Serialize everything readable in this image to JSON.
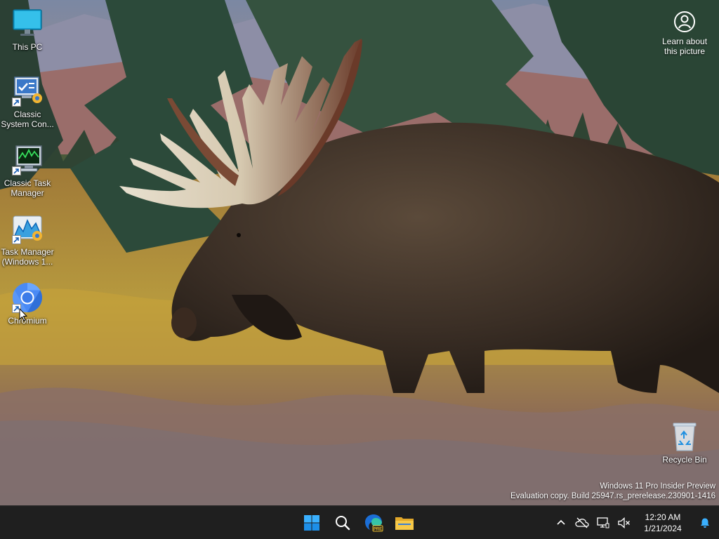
{
  "desktop": {
    "icons": [
      {
        "label": "This PC",
        "icon": "monitor-icon"
      },
      {
        "label": "Classic System Con...",
        "icon": "control-panel-icon"
      },
      {
        "label": "Classic Task Manager",
        "icon": "task-manager-classic-icon"
      },
      {
        "label": "Task Manager (Windows 1...",
        "icon": "task-manager-icon"
      },
      {
        "label": "Chromium",
        "icon": "chromium-icon"
      }
    ],
    "recycle_bin": {
      "label": "Recycle Bin",
      "icon": "recycle-bin-icon"
    },
    "learn_about": {
      "label": "Learn about this picture",
      "icon": "camera-info-icon"
    }
  },
  "watermark": {
    "line1": "Windows 11 Pro Insider Preview",
    "line2": "Evaluation copy. Build 25947.rs_prerelease.230901-1416"
  },
  "taskbar": {
    "pinned": [
      {
        "name": "start",
        "icon": "windows-logo-icon"
      },
      {
        "name": "search",
        "icon": "search-icon"
      },
      {
        "name": "edge-preview",
        "icon": "edge-pre-icon"
      },
      {
        "name": "file-explorer",
        "icon": "folder-icon"
      }
    ],
    "tray": [
      {
        "name": "show-hidden",
        "icon": "chevron-up-icon"
      },
      {
        "name": "onedrive",
        "icon": "cloud-off-icon"
      },
      {
        "name": "network",
        "icon": "network-icon"
      },
      {
        "name": "volume",
        "icon": "volume-muted-icon"
      }
    ],
    "time": "12:20 AM",
    "date": "1/21/2024"
  },
  "colors": {
    "taskbar_bg": "#1f1f1f",
    "accent_blue": "#0078d4"
  }
}
